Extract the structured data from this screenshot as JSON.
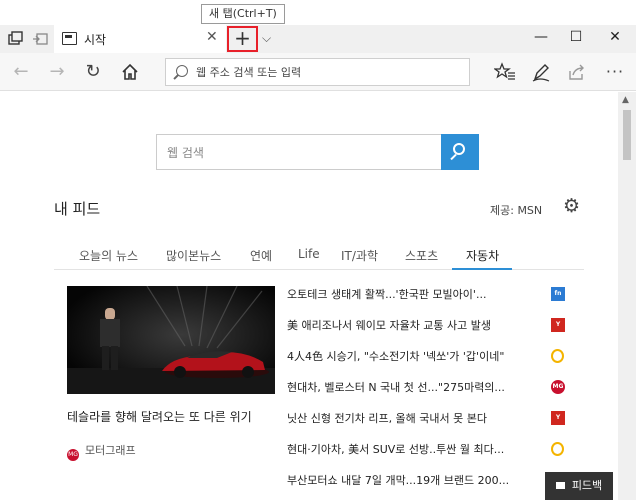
{
  "tooltip": "새 탭(Ctrl+T)",
  "tab": {
    "title": "시작"
  },
  "address": {
    "placeholder": "웹 주소 검색 또는 입력"
  },
  "search": {
    "placeholder": "웹 검색"
  },
  "feed": {
    "title": "내 피드",
    "provider": "제공: MSN",
    "tabs": [
      {
        "label": "오늘의 뉴스"
      },
      {
        "label": "많이본뉴스"
      },
      {
        "label": "연예"
      },
      {
        "label": "Life"
      },
      {
        "label": "IT/과학"
      },
      {
        "label": "스포츠"
      },
      {
        "label": "자동차",
        "active": true
      }
    ],
    "hero": {
      "caption": "테슬라를 향해 달려오는 또 다른 위기",
      "source": "모터그래프"
    },
    "news": [
      {
        "title": "오토테크 생태계 활짝...'한국판 모빌아이'...",
        "source_icon": "fn-icon"
      },
      {
        "title": "美 애리조나서 웨이모 자율차 교통 사고 발생",
        "source_icon": "yonhap-icon"
      },
      {
        "title": "4人4色 시승기, \"수소전기차 '넥쏘'가 '갑'이네\"",
        "source_icon": "ring-icon"
      },
      {
        "title": "현대차, 벨로스터 N 국내 첫 선...\"275마력의...",
        "source_icon": "motorgraph-icon"
      },
      {
        "title": "닛산 신형 전기차 리프, 올해 국내서 못 본다",
        "source_icon": "yonhap-icon"
      },
      {
        "title": "현대·기아차, 美서 SUV로 선방..투싼 월 최다...",
        "source_icon": "ring-icon"
      },
      {
        "title": "부산모터쇼 내달 7일 개막...19개 브랜드 200...",
        "source_icon": "yonhap-icon"
      }
    ]
  },
  "feedback": {
    "label": "피드백"
  },
  "colors": {
    "accent": "#2d8fd6",
    "highlight": "#e8202a"
  }
}
